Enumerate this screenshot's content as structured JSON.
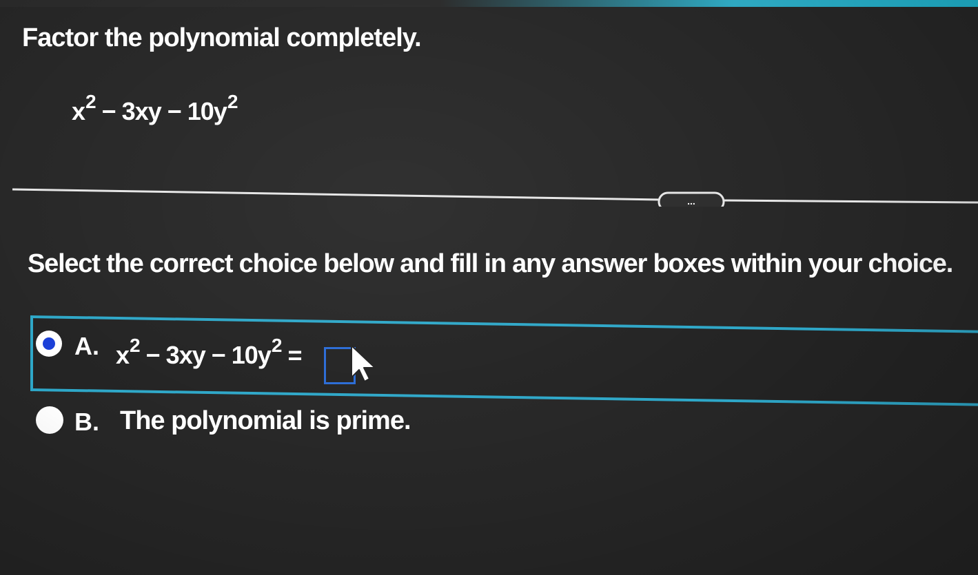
{
  "question": {
    "instruction": "Factor the polynomial completely.",
    "expression": {
      "t1_base": "x",
      "t1_exp": "2",
      "t2": " − 3xy − 10y",
      "t2_exp": "2"
    }
  },
  "divider": {
    "expand_label": "..."
  },
  "prompt": "Select the correct choice below and fill in any answer boxes within your choice.",
  "choices": [
    {
      "letter": "A.",
      "selected": true,
      "expr_base": "x",
      "expr_exp": "2",
      "expr_mid": " − 3xy − 10y",
      "expr_exp2": "2",
      "expr_equals": " =",
      "answer_value": ""
    },
    {
      "letter": "B.",
      "selected": false,
      "text": "The polynomial is prime."
    }
  ],
  "colors": {
    "background": "#262626",
    "selection_border": "#2ea7c8",
    "radio_selected_dot": "#1b3fd8",
    "answer_box_border": "#2a6bd6"
  },
  "icons": [
    "ellipsis-expand-icon",
    "mouse-pointer-icon"
  ]
}
